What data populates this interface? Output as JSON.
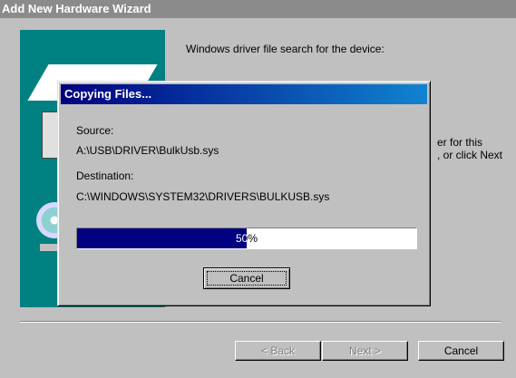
{
  "wizard": {
    "title": "Add New Hardware Wizard",
    "heading": "Windows driver file search for the device:",
    "body_line1": "er for this",
    "body_line2": ", or click Next",
    "back_label": "< Back",
    "next_label": "Next >",
    "cancel_label": "Cancel"
  },
  "copy_dialog": {
    "title": "Copying Files...",
    "source_label": "Source:",
    "source_value": "A:\\USB\\DRIVER\\BulkUsb.sys",
    "destination_label": "Destination:",
    "destination_value": "C:\\WINDOWS\\SYSTEM32\\DRIVERS\\BULKUSB.sys",
    "progress_percent": 50,
    "progress_text": "50%",
    "cancel_label": "Cancel"
  },
  "colors": {
    "title_active": "#000080",
    "title_inactive": "#8b8b8b",
    "face": "#c0c0c0",
    "art_bg": "#008080"
  }
}
